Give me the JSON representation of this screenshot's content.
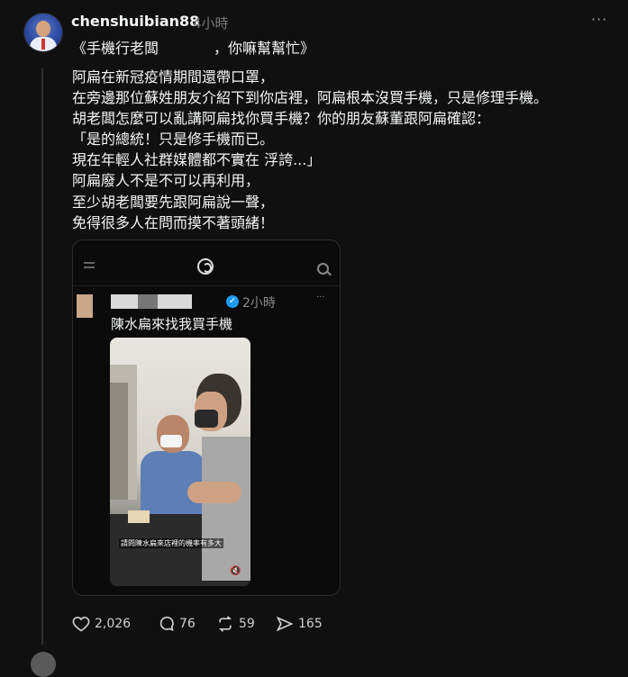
{
  "post": {
    "username": "chenshuibian88",
    "time": "4小時",
    "more": "···",
    "title": "《手機行老闆            ，你嘛幫幫忙》",
    "lines": [
      "阿扁在新冠疫情期間還帶口罩，",
      "在旁邊那位蘇姓朋友介紹下到你店裡，阿扁根本沒買手機，只是修理手機。",
      "胡老闆怎麼可以亂講阿扁找你買手機？你的朋友蘇董跟阿扁確認：",
      "「是的總統！只是修手機而已。",
      "現在年輕人社群媒體都不實在 浮誇...」",
      "阿扁廢人不是不可以再利用，",
      "至少胡老闆要先跟阿扁說一聲，",
      "免得很多人在問而摸不著頭緒！"
    ]
  },
  "embed": {
    "time": "2小時",
    "more": "···",
    "text": "陳水扁來找我買手機",
    "subtitle": "請問陳水扁來店裡的機率有多大"
  },
  "actions": {
    "likes": "2,026",
    "comments": "76",
    "reposts": "59",
    "shares": "165"
  }
}
